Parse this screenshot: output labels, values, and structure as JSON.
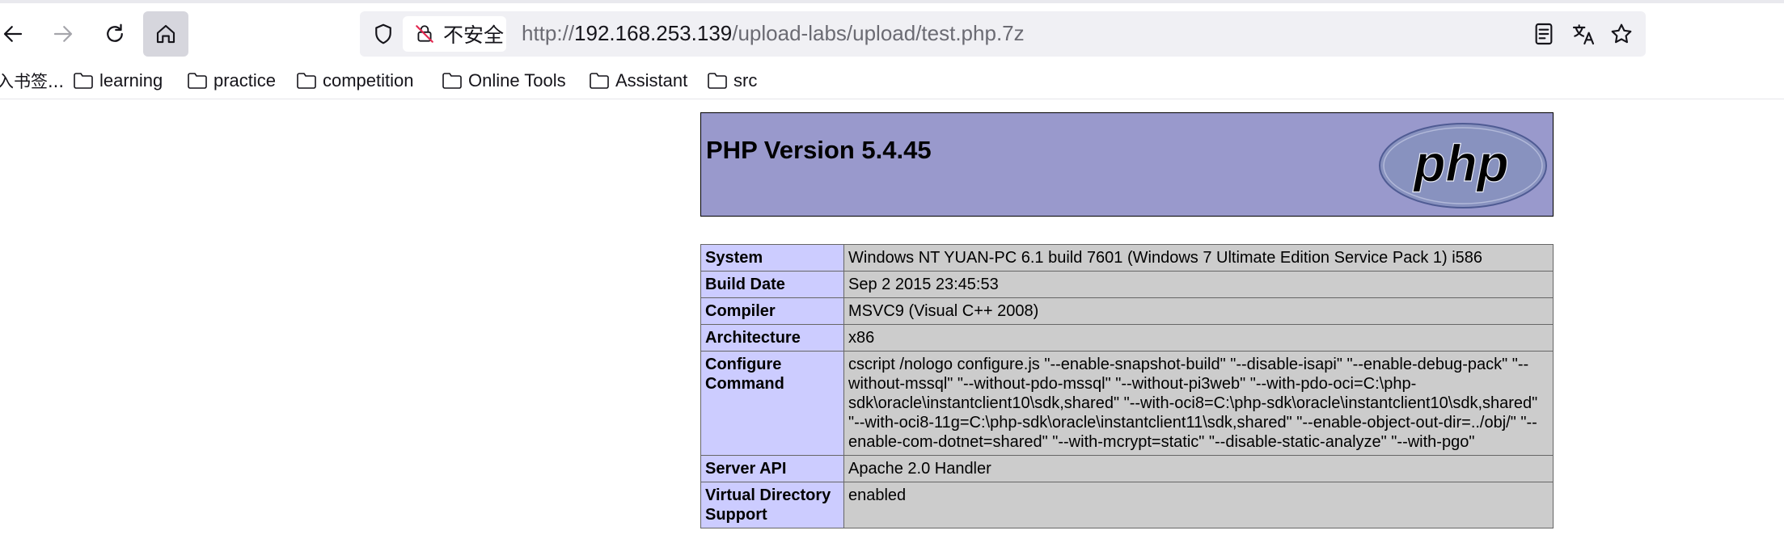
{
  "browser": {
    "url_scheme": "http://",
    "url_host": "192.168.253.139",
    "url_path": "/upload-labs/upload/test.php.7z",
    "security_label": "不安全"
  },
  "bookmarks": [
    {
      "label": "入书签...",
      "icon": "none"
    },
    {
      "label": "learning",
      "icon": "folder-icon"
    },
    {
      "label": "practice",
      "icon": "folder-icon"
    },
    {
      "label": "competition",
      "icon": "folder-icon"
    },
    {
      "label": "Online Tools",
      "icon": "folder-icon"
    },
    {
      "label": "Assistant",
      "icon": "folder-icon"
    },
    {
      "label": "src",
      "icon": "folder-icon"
    }
  ],
  "phpinfo": {
    "title": "PHP Version 5.4.45",
    "logo_text": "php",
    "rows": [
      {
        "key": "System",
        "value": "Windows NT YUAN-PC 6.1 build 7601 (Windows 7 Ultimate Edition Service Pack 1) i586"
      },
      {
        "key": "Build Date",
        "value": "Sep 2 2015 23:45:53"
      },
      {
        "key": "Compiler",
        "value": "MSVC9 (Visual C++ 2008)"
      },
      {
        "key": "Architecture",
        "value": "x86"
      },
      {
        "key": "Configure Command",
        "value": "cscript /nologo configure.js \"--enable-snapshot-build\" \"--disable-isapi\" \"--enable-debug-pack\" \"--without-mssql\" \"--without-pdo-mssql\" \"--without-pi3web\" \"--with-pdo-oci=C:\\php-sdk\\oracle\\instantclient10\\sdk,shared\" \"--with-oci8=C:\\php-sdk\\oracle\\instantclient10\\sdk,shared\" \"--with-oci8-11g=C:\\php-sdk\\oracle\\instantclient11\\sdk,shared\" \"--enable-object-out-dir=../obj/\" \"--enable-com-dotnet=shared\" \"--with-mcrypt=static\" \"--disable-static-analyze\" \"--with-pgo\""
      },
      {
        "key": "Server API",
        "value": "Apache 2.0 Handler"
      },
      {
        "key": "Virtual Directory Support",
        "value": "enabled"
      }
    ]
  },
  "colors": {
    "header_bg": "#9999cc",
    "key_cell_bg": "#ccccff",
    "value_cell_bg": "#cccccc"
  }
}
